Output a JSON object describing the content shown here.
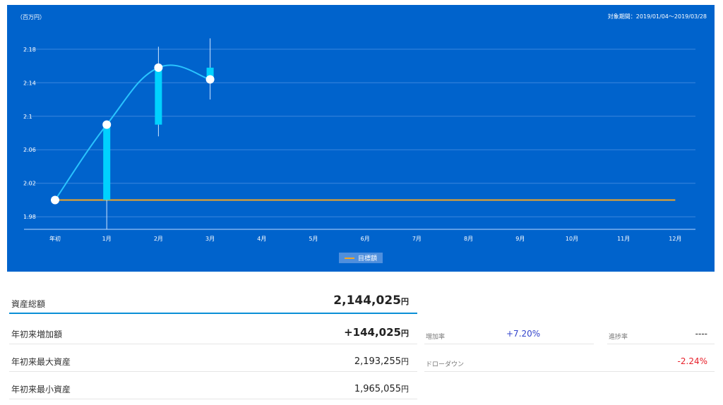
{
  "chart": {
    "unit_label": "（百万円）",
    "period_label": "対象期間：2019/01/04～2019/03/28",
    "legend_label": "目標額",
    "colors": {
      "background": "#0063cc",
      "candle": "#00d2ff",
      "line": "#29c4ff",
      "target": "#f5a623",
      "grid": "#3a86dd"
    }
  },
  "chart_data": {
    "type": "candlestick-line",
    "x_categories": [
      "年初",
      "1月",
      "2月",
      "3月",
      "4月",
      "5月",
      "6月",
      "7月",
      "8月",
      "9月",
      "10月",
      "11月",
      "12月"
    ],
    "y_ticks": [
      "1.98",
      "2.02",
      "2.06",
      "2.1",
      "2.14",
      "2.18"
    ],
    "ylim": [
      1.965,
      2.195
    ],
    "candles": [
      {
        "category": "1月",
        "open": 2.0,
        "close": 2.09,
        "high": 2.09,
        "low": 1.965
      },
      {
        "category": "2月",
        "open": 2.09,
        "close": 2.158,
        "high": 2.183,
        "low": 2.076
      },
      {
        "category": "3月",
        "open": 2.158,
        "close": 2.144,
        "high": 2.193,
        "low": 2.12
      }
    ],
    "line_points": [
      {
        "category": "年初",
        "value": 2.0
      },
      {
        "category": "1月",
        "value": 2.09
      },
      {
        "category": "2月",
        "value": 2.158
      },
      {
        "category": "3月",
        "value": 2.144
      }
    ],
    "target": {
      "name": "目標額",
      "value": 2.0
    },
    "grid": true,
    "legend": "bottom-center"
  },
  "summary": {
    "total_label": "資産総額",
    "total_value": "2,144,025",
    "ytd_increase_label": "年初来増加額",
    "ytd_increase_value": "+144,025",
    "ytd_max_label": "年初来最大資産",
    "ytd_max_value": "2,193,255",
    "ytd_min_label": "年初来最小資産",
    "ytd_min_value": "1,965,055",
    "yen": "円"
  },
  "stats": {
    "increase_rate_label": "増加率",
    "increase_rate_value": "+7.20%",
    "progress_rate_label": "進捗率",
    "progress_rate_value": "----",
    "drawdown_label": "ドローダウン",
    "drawdown_value": "-2.24%"
  }
}
